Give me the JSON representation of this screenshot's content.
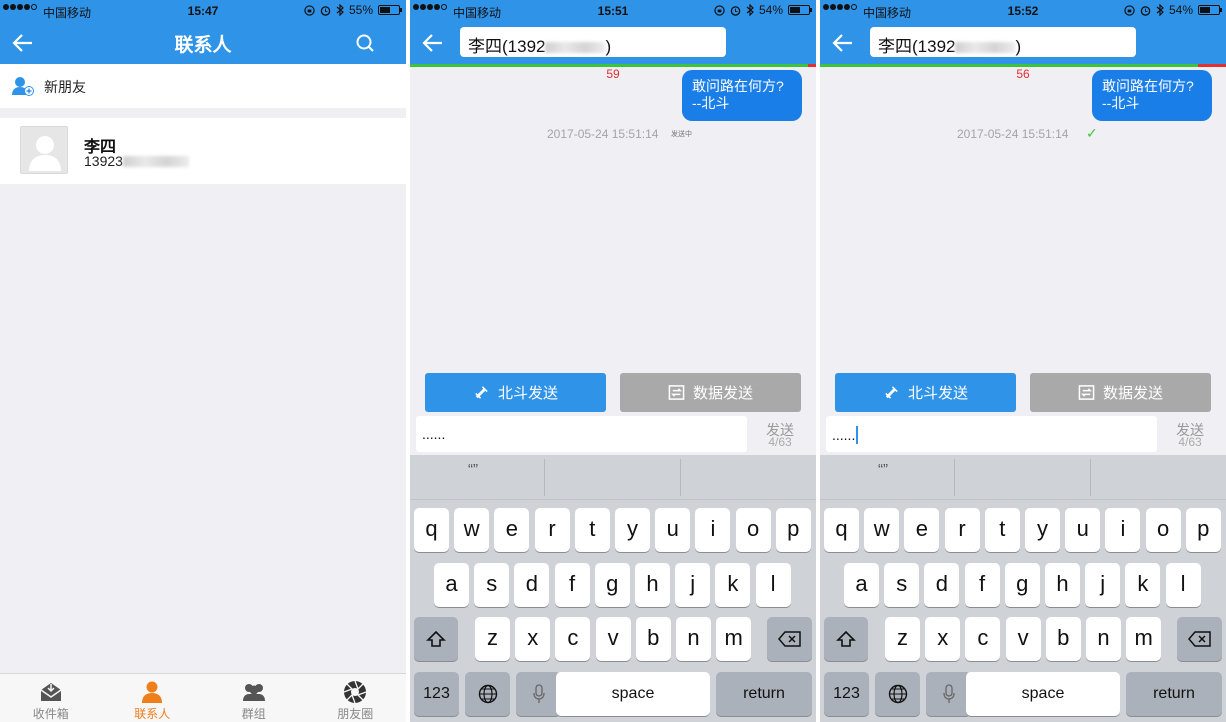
{
  "panel1": {
    "status": {
      "carrier": "中国移动",
      "time": "15:47",
      "battery": "55%",
      "battery_level": 0.55
    },
    "nav": {
      "title": "联系人"
    },
    "new_friend": {
      "label": "新朋友"
    },
    "contact": {
      "name": "李四",
      "phone_visible": "13923"
    },
    "tabs": [
      {
        "label": "收件箱",
        "icon": "inbox-icon",
        "active": false
      },
      {
        "label": "联系人",
        "icon": "person-icon",
        "active": true
      },
      {
        "label": "群组",
        "icon": "group-icon",
        "active": false
      },
      {
        "label": "朋友圈",
        "icon": "aperture-icon",
        "active": false
      }
    ],
    "colors": {
      "accent": "#2f93e8",
      "active_tab": "#ef7e1b"
    }
  },
  "panel2": {
    "status": {
      "carrier": "中国移动",
      "time": "15:51",
      "battery": "54%",
      "battery_level": 0.54
    },
    "nav": {
      "recipient_prefix": "李四(1392",
      "recipient_suffix": ")"
    },
    "counter": "59",
    "message": {
      "line1": "敢问路在何方?",
      "line2": "--北斗"
    },
    "timestamp": "2017-05-24 15:51:14",
    "state_text": "发送中",
    "buttons": {
      "beidou": "北斗发送",
      "data": "数据发送"
    },
    "input": {
      "value": "......",
      "send": "发送",
      "count": "4/63"
    }
  },
  "panel3": {
    "status": {
      "carrier": "中国移动",
      "time": "15:52",
      "battery": "54%",
      "battery_level": 0.54
    },
    "nav": {
      "recipient_prefix": "李四(1392",
      "recipient_suffix": ")"
    },
    "counter": "56",
    "message": {
      "line1": "敢问路在何方?",
      "line2": "--北斗"
    },
    "timestamp": "2017-05-24 15:51:14",
    "state_text": "✓",
    "buttons": {
      "beidou": "北斗发送",
      "data": "数据发送"
    },
    "input": {
      "value": "......",
      "send": "发送",
      "count": "4/63"
    }
  },
  "keyboard": {
    "suggestion": "“”",
    "row1": [
      "q",
      "w",
      "e",
      "r",
      "t",
      "y",
      "u",
      "i",
      "o",
      "p"
    ],
    "row2": [
      "a",
      "s",
      "d",
      "f",
      "g",
      "h",
      "j",
      "k",
      "l"
    ],
    "row3": [
      "z",
      "x",
      "c",
      "v",
      "b",
      "n",
      "m"
    ],
    "numbers": "123",
    "space": "space",
    "return": "return"
  }
}
